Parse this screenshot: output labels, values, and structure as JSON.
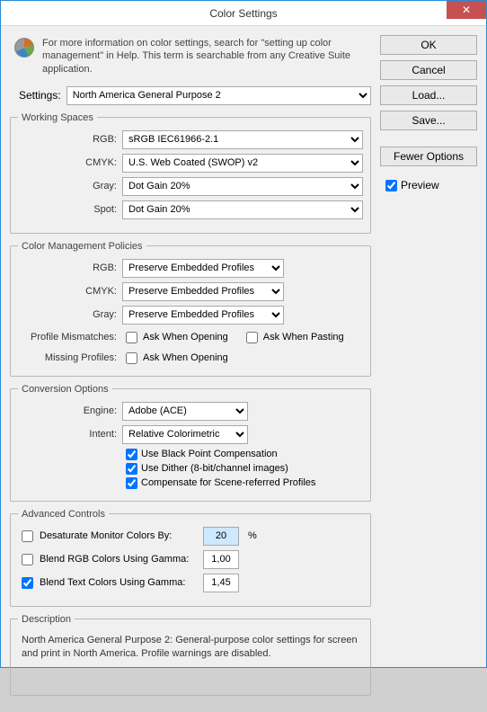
{
  "window": {
    "title": "Color Settings"
  },
  "info": {
    "text": "For more information on color settings, search for \"setting up color management\" in Help. This term is searchable from any Creative Suite application."
  },
  "settings": {
    "label": "Settings:",
    "value": "North America General Purpose 2"
  },
  "working_spaces": {
    "legend": "Working Spaces",
    "rgb_label": "RGB:",
    "rgb_value": "sRGB IEC61966-2.1",
    "cmyk_label": "CMYK:",
    "cmyk_value": "U.S. Web Coated (SWOP) v2",
    "gray_label": "Gray:",
    "gray_value": "Dot Gain 20%",
    "spot_label": "Spot:",
    "spot_value": "Dot Gain 20%"
  },
  "policies": {
    "legend": "Color Management Policies",
    "rgb_label": "RGB:",
    "rgb_value": "Preserve Embedded Profiles",
    "cmyk_label": "CMYK:",
    "cmyk_value": "Preserve Embedded Profiles",
    "gray_label": "Gray:",
    "gray_value": "Preserve Embedded Profiles",
    "mismatch_label": "Profile Mismatches:",
    "mismatch_open": "Ask When Opening",
    "mismatch_paste": "Ask When Pasting",
    "missing_label": "Missing Profiles:",
    "missing_open": "Ask When Opening"
  },
  "conversion": {
    "legend": "Conversion Options",
    "engine_label": "Engine:",
    "engine_value": "Adobe (ACE)",
    "intent_label": "Intent:",
    "intent_value": "Relative Colorimetric",
    "bpc_label": "Use Black Point Compensation",
    "dither_label": "Use Dither (8-bit/channel images)",
    "scene_label": "Compensate for Scene-referred Profiles"
  },
  "advanced": {
    "legend": "Advanced Controls",
    "desat_label": "Desaturate Monitor Colors By:",
    "desat_value": "20",
    "desat_unit": "%",
    "blend_rgb_label": "Blend RGB Colors Using Gamma:",
    "blend_rgb_value": "1,00",
    "blend_text_label": "Blend Text Colors Using Gamma:",
    "blend_text_value": "1,45"
  },
  "description": {
    "legend": "Description",
    "text": "North America General Purpose 2:  General-purpose color settings for screen and print in North America. Profile warnings are disabled."
  },
  "buttons": {
    "ok": "OK",
    "cancel": "Cancel",
    "load": "Load...",
    "save": "Save...",
    "fewer": "Fewer Options",
    "preview": "Preview"
  }
}
